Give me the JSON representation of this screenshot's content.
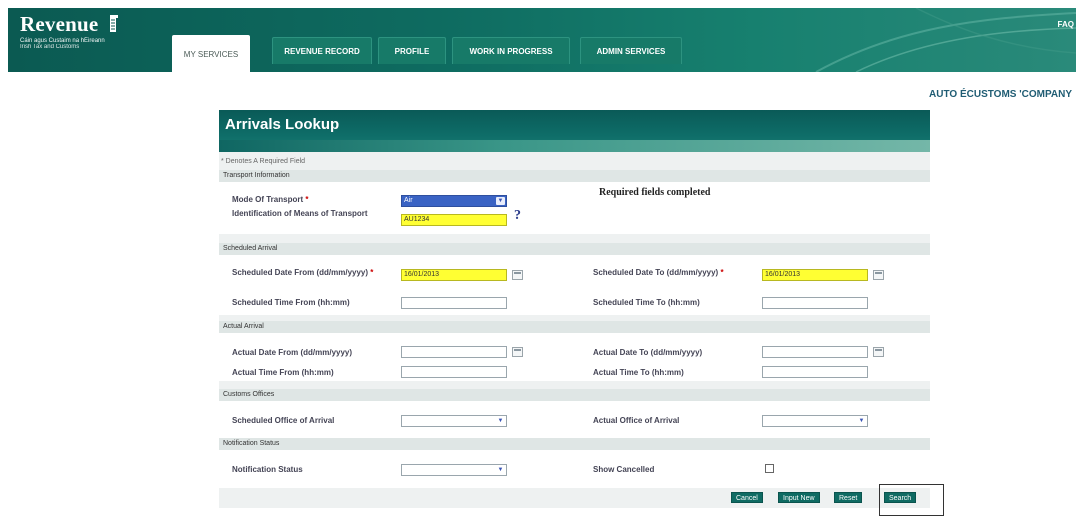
{
  "header": {
    "logo_title": "Revenue",
    "logo_sub1": "Cáin agus Custaim na hÉireann",
    "logo_sub2": "Irish Tax and Customs",
    "faq": "FAQ",
    "tabs": [
      {
        "label": "MY SERVICES",
        "active": true
      },
      {
        "label": "REVENUE RECORD",
        "active": false
      },
      {
        "label": "PROFILE",
        "active": false
      },
      {
        "label": "WORK IN PROGRESS",
        "active": false
      },
      {
        "label": "ADMIN SERVICES",
        "active": false
      }
    ]
  },
  "company": "AUTO ÉCUSTOMS 'COMPANY",
  "panel": {
    "title": "Arrivals Lookup",
    "note": "* Denotes A Required Field",
    "required_message": "Required fields completed",
    "sections": {
      "transport": "Transport Information",
      "scheduled": "Scheduled Arrival",
      "actual": "Actual Arrival",
      "offices": "Customs Offices",
      "notification": "Notification Status"
    },
    "fields": {
      "mode_of_transport": {
        "label": "Mode Of Transport",
        "value": "Air"
      },
      "identification": {
        "label": "Identification of Means of Transport",
        "value": "AU1234"
      },
      "sched_date_from": {
        "label": "Scheduled Date From (dd/mm/yyyy)",
        "value": "16/01/2013"
      },
      "sched_date_to": {
        "label": "Scheduled Date To (dd/mm/yyyy)",
        "value": "16/01/2013"
      },
      "sched_time_from": {
        "label": "Scheduled Time From (hh:mm)",
        "value": ""
      },
      "sched_time_to": {
        "label": "Scheduled Time To (hh:mm)",
        "value": ""
      },
      "actual_date_from": {
        "label": "Actual Date From (dd/mm/yyyy)",
        "value": ""
      },
      "actual_date_to": {
        "label": "Actual Date To (dd/mm/yyyy)",
        "value": ""
      },
      "actual_time_from": {
        "label": "Actual Time From (hh:mm)",
        "value": ""
      },
      "actual_time_to": {
        "label": "Actual Time To (hh:mm)",
        "value": ""
      },
      "sched_office": {
        "label": "Scheduled Office of Arrival",
        "value": ""
      },
      "actual_office": {
        "label": "Actual Office of Arrival",
        "value": ""
      },
      "notification_status": {
        "label": "Notification Status",
        "value": ""
      },
      "show_cancelled": {
        "label": "Show Cancelled",
        "checked": false
      }
    },
    "buttons": {
      "cancel": "Cancel",
      "input_new": "Input New",
      "reset": "Reset",
      "search": "Search"
    }
  },
  "icons": {
    "calendar": "calendar-icon",
    "dropdown": "chevron-down-icon",
    "help": "help-icon"
  }
}
